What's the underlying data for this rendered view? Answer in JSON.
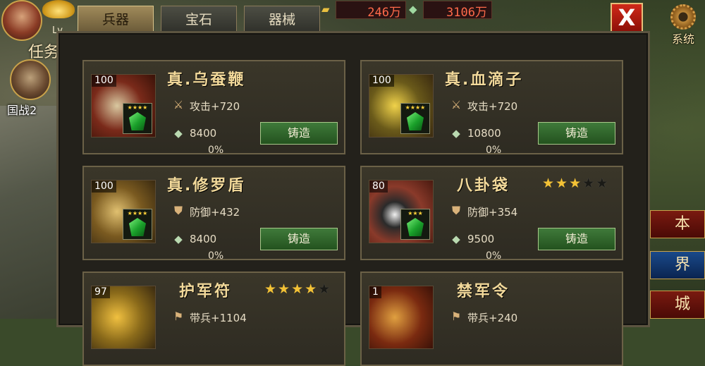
{
  "top": {
    "level_text": "Lv",
    "resource1": "246万",
    "resource2": "3106万",
    "close_label": "X",
    "system_label": "系统"
  },
  "tabs": [
    {
      "label": "兵器",
      "active": true
    },
    {
      "label": "宝石",
      "active": false
    },
    {
      "label": "器械",
      "active": false
    }
  ],
  "left_side": {
    "task_label": "任务",
    "guozhan_label": "国战2"
  },
  "right_side": {
    "btn1": "本",
    "btn2": "界",
    "btn3": "城"
  },
  "forge_label": "铸造",
  "items": [
    {
      "level": "100",
      "name": "真.乌蚕鞭",
      "stat": "攻击+720",
      "stat_icon": "sword-icon",
      "cost": "8400",
      "progress": "0%",
      "stars": null,
      "gem_stars": "★★★★",
      "colors": {
        "img": "#7a2a1a"
      }
    },
    {
      "level": "100",
      "name": "真.血滴子",
      "stat": "攻击+720",
      "stat_icon": "sword-icon",
      "cost": "10800",
      "progress": "0%",
      "stars": null,
      "gem_stars": "★★★★",
      "colors": {
        "img": "#6a5a1a"
      }
    },
    {
      "level": "100",
      "name": "真.修罗盾",
      "stat": "防御+432",
      "stat_icon": "shield-icon",
      "cost": "8400",
      "progress": "0%",
      "stars": null,
      "gem_stars": "★★★★",
      "colors": {
        "img": "#7a5a20"
      }
    },
    {
      "level": "80",
      "name": "八卦袋",
      "stat": "防御+354",
      "stat_icon": "shield-icon",
      "cost": "9500",
      "progress": "0%",
      "stars": 3,
      "gem_stars": "★★★",
      "colors": {
        "img": "#8a3a2a"
      }
    },
    {
      "level": "97",
      "name": "护军符",
      "stat": "带兵+1104",
      "stat_icon": "troops-icon",
      "cost": "",
      "progress": "",
      "stars": 4,
      "gem_stars": "",
      "colors": {
        "img": "#8a6a1a"
      }
    },
    {
      "level": "1",
      "name": "禁军令",
      "stat": "带兵+240",
      "stat_icon": "troops-icon",
      "cost": "",
      "progress": "",
      "stars": null,
      "gem_stars": "",
      "colors": {
        "img": "#7a2a10"
      }
    }
  ]
}
